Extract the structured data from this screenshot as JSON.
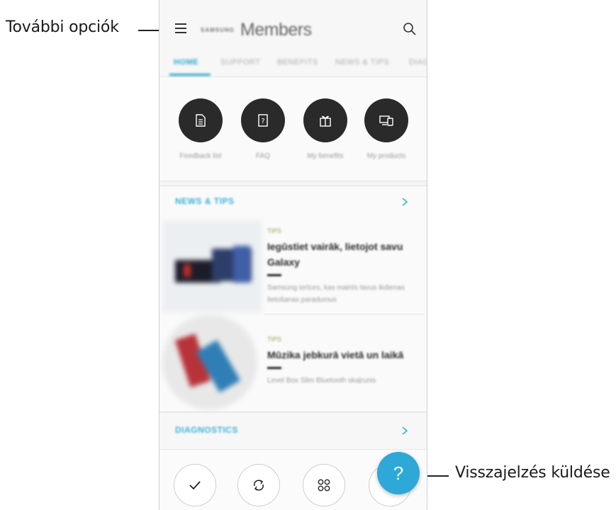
{
  "callouts": {
    "more_options": "További opciók",
    "send_feedback": "Visszajelzés küldése"
  },
  "app": {
    "brand_small": "SAMSUNG",
    "brand_name": "Members"
  },
  "tabs": [
    "HOME",
    "SUPPORT",
    "BENEFITS",
    "NEWS & TIPS",
    "DIAG"
  ],
  "quick_actions": [
    {
      "label": "Feedback list",
      "icon": "document-icon"
    },
    {
      "label": "FAQ",
      "icon": "faq-book-icon"
    },
    {
      "label": "My benefits",
      "icon": "gift-icon"
    },
    {
      "label": "My products",
      "icon": "devices-icon"
    }
  ],
  "news_section": {
    "title": "NEWS & TIPS",
    "articles": [
      {
        "tag": "TIPS",
        "title": "Iegūstiet vairāk, lietojot savu Galaxy",
        "desc": "Samsung ierīces, kas mainīs tavus ikdienas lietošanas paradumus"
      },
      {
        "tag": "TIPS",
        "title": "Mūzika jebkurā vietā un laikā",
        "desc": "Level Box Slim Bluetooth skaļrunis"
      }
    ]
  },
  "diagnostics": {
    "title": "DIAGNOSTICS"
  },
  "bottom_actions": [
    {
      "icon": "check-icon"
    },
    {
      "icon": "sync-icon"
    },
    {
      "icon": "apps-grid-icon"
    }
  ],
  "fab": {
    "label": "?",
    "color": "#2ea8d6"
  },
  "accent_color": "#2aa6cc"
}
